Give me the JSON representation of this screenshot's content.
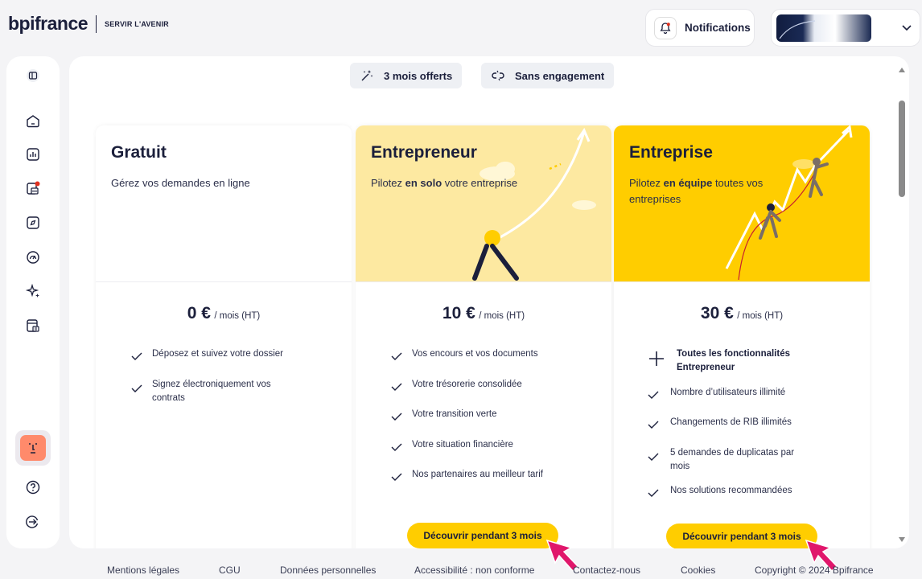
{
  "brand": {
    "name": "bpifrance",
    "tagline": "SERVIR L'AVENIR"
  },
  "header": {
    "notifications_label": "Notifications"
  },
  "sidebar": {
    "items": [
      {
        "icon": "layout-toggle-icon"
      },
      {
        "icon": "home-icon"
      },
      {
        "icon": "chart-icon"
      },
      {
        "icon": "bank-notification-icon"
      },
      {
        "icon": "compass-icon"
      },
      {
        "icon": "gauge-icon"
      },
      {
        "icon": "sparkle-icon"
      },
      {
        "icon": "calculator-icon"
      },
      {
        "icon": "help-icon"
      },
      {
        "icon": "logout-icon"
      }
    ],
    "colors": {
      "notification_dot": "#e0301e",
      "avatar_bg": "#ff8a6b"
    }
  },
  "chips": [
    {
      "label": "3 mois offerts",
      "icon": "magic-wand-icon"
    },
    {
      "label": "Sans engagement",
      "icon": "unlink-icon"
    }
  ],
  "plans": [
    {
      "title": "Gratuit",
      "desc": "Gérez vos demandes en ligne",
      "price": "0 €",
      "price_unit": "/ mois (HT)",
      "features": [
        "Déposez et suivez votre dossier",
        "Signez électroniquement vos contrats"
      ]
    },
    {
      "title": "Entrepreneur",
      "desc_pre": "Pilotez ",
      "desc_bold": "en solo",
      "desc_post": " votre entreprise",
      "price": "10 €",
      "price_unit": "/ mois (HT)",
      "features": [
        "Vos encours et vos documents",
        "Votre trésorerie consolidée",
        "Votre transition verte",
        "Votre situation financière",
        "Nos partenaires au meilleur tarif"
      ],
      "cta": "Découvrir pendant 3 mois",
      "bg": "#fde9a1"
    },
    {
      "title": "Entreprise",
      "desc_pre": "Pilotez ",
      "desc_bold": "en équipe",
      "desc_post": " toutes vos entreprises",
      "price": "30 €",
      "price_unit": "/ mois (HT)",
      "feature_highlight": "Toutes les fonctionnalités Entrepreneur",
      "features": [
        "Nombre d’utilisateurs illimité",
        "Changements de RIB illimités",
        "5 demandes de duplicatas par mois",
        "Nos solutions recommandées"
      ],
      "cta": "Découvrir pendant 3 mois",
      "bg": "#ffcd00"
    }
  ],
  "footer": {
    "links": [
      "Mentions légales",
      "CGU",
      "Données personnelles",
      "Accessibilité : non conforme",
      "Contactez-nous",
      "Cookies",
      "Copyright © 2024 Bpifrance"
    ]
  },
  "colors": {
    "accent": "#ffcd00",
    "navy": "#1b1f3b",
    "cursor": "#e0176b"
  }
}
